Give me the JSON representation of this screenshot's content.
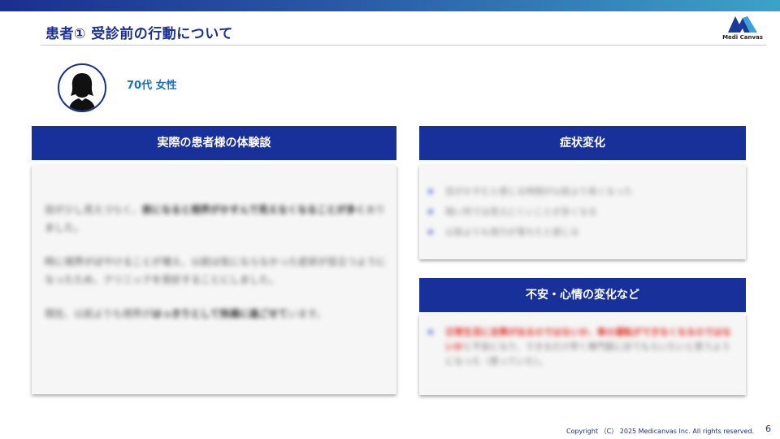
{
  "slide": {
    "title": "患者① 受診前の行動について",
    "brand": "Medi Canvas",
    "page_number": "6",
    "copyright": "Copyright （C） 2025 Medicanvas Inc. All rights reserved."
  },
  "patient": {
    "label": "70代 女性",
    "avatar_icon": "woman-silhouette-icon"
  },
  "experience_panel": {
    "heading": "実際の患者様の体験談",
    "paragraphs": [
      {
        "plain": "目が少し見えづらく、",
        "strong": "夜になると視界がかすんで見えなくなることが多く",
        "after": "ありました。"
      },
      {
        "plain": "時に視界がぼやけることが増え、以前は気にならなかった症状が目立つようになったため、クリニックを受診することにしました。",
        "strong": "",
        "after": ""
      },
      {
        "plain": "現在、以前よりも視界が",
        "strong": "はっきりとして快適に過ごせて",
        "after": "います。"
      }
    ]
  },
  "symptoms_panel": {
    "heading": "症状変化",
    "items": [
      "目がかすむと感じる時間が以前より長くなった",
      "暗い所では見えにくいことが多くなる",
      "以前よりも視力が落ちたと感じる"
    ]
  },
  "anxiety_panel": {
    "heading": "不安・心情の変化など",
    "items": [
      {
        "red": "日常生活に支障が出るのではないか、車の運転ができなくなるのではないか",
        "rest": "と不安になり、できるだけ早く専門医に診てもらいたいと思うようになった（思っていた）。"
      }
    ]
  },
  "colors": {
    "navy": "#17309a",
    "accent_blue": "#1a6fc4",
    "alert_red": "#e0352b",
    "gradient_end": "#3ca3c8"
  }
}
